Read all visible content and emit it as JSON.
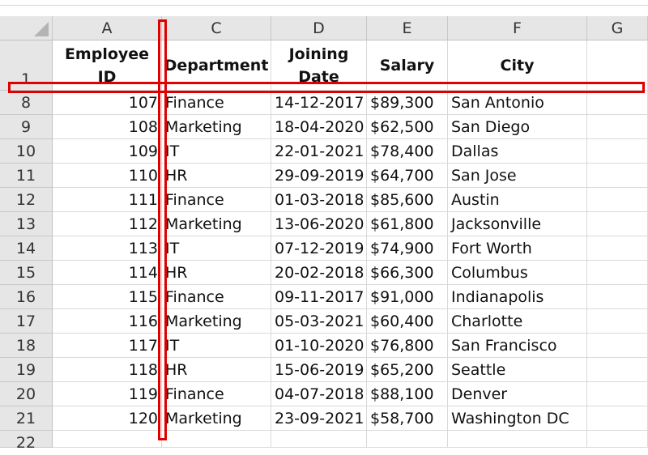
{
  "columns": [
    "A",
    "C",
    "D",
    "E",
    "F",
    "G"
  ],
  "header_row": {
    "row_number": "1",
    "cells": [
      "Employee ID",
      "Department",
      "Joining Date",
      "Salary",
      "City",
      ""
    ]
  },
  "rows": [
    {
      "n": "8",
      "id": "107",
      "dept": "Finance",
      "date": "14-12-2017",
      "salary": "$89,300",
      "city": "San Antonio"
    },
    {
      "n": "9",
      "id": "108",
      "dept": "Marketing",
      "date": "18-04-2020",
      "salary": "$62,500",
      "city": "San Diego"
    },
    {
      "n": "10",
      "id": "109",
      "dept": "IT",
      "date": "22-01-2021",
      "salary": "$78,400",
      "city": "Dallas"
    },
    {
      "n": "11",
      "id": "110",
      "dept": "HR",
      "date": "29-09-2019",
      "salary": "$64,700",
      "city": "San Jose"
    },
    {
      "n": "12",
      "id": "111",
      "dept": "Finance",
      "date": "01-03-2018",
      "salary": "$85,600",
      "city": "Austin"
    },
    {
      "n": "13",
      "id": "112",
      "dept": "Marketing",
      "date": "13-06-2020",
      "salary": "$61,800",
      "city": "Jacksonville"
    },
    {
      "n": "14",
      "id": "113",
      "dept": "IT",
      "date": "07-12-2019",
      "salary": "$74,900",
      "city": "Fort Worth"
    },
    {
      "n": "15",
      "id": "114",
      "dept": "HR",
      "date": "20-02-2018",
      "salary": "$66,300",
      "city": "Columbus"
    },
    {
      "n": "16",
      "id": "115",
      "dept": "Finance",
      "date": "09-11-2017",
      "salary": "$91,000",
      "city": "Indianapolis"
    },
    {
      "n": "17",
      "id": "116",
      "dept": "Marketing",
      "date": "05-03-2021",
      "salary": "$60,400",
      "city": "Charlotte"
    },
    {
      "n": "18",
      "id": "117",
      "dept": "IT",
      "date": "01-10-2020",
      "salary": "$76,800",
      "city": "San Francisco"
    },
    {
      "n": "19",
      "id": "118",
      "dept": "HR",
      "date": "15-06-2019",
      "salary": "$65,200",
      "city": "Seattle"
    },
    {
      "n": "20",
      "id": "119",
      "dept": "Finance",
      "date": "04-07-2018",
      "salary": "$88,100",
      "city": "Denver"
    },
    {
      "n": "21",
      "id": "120",
      "dept": "Marketing",
      "date": "23-09-2021",
      "salary": "$58,700",
      "city": "Washington DC"
    }
  ],
  "last_row_number": "22",
  "highlight_color": "#e00000",
  "icons": {
    "corner": "select-all-triangle-icon"
  }
}
